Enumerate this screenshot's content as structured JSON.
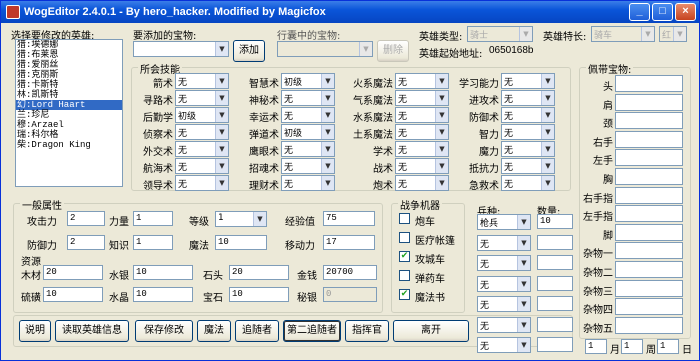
{
  "window": {
    "title": "WogEditor 2.4.0.1 - By  hero_hacker.  Modified by Magicfox",
    "minimize": "_",
    "maximize": "□",
    "close": "×"
  },
  "hero_list": {
    "label": "选择要修改的英雄:",
    "items": [
      "猎:埃德娜",
      "猎:布莱恩",
      "猎:爱丽丝",
      "猎:克丽斯",
      "猎:卡斯特",
      "林:凯斯特",
      "幻:Lord Haart",
      "兰:珍尼",
      "穆:Arzael",
      "瑞:科尔格",
      "柴:Dragon King"
    ],
    "selected_index": 6
  },
  "artifact_add": {
    "label": "要添加的宝物:",
    "value": "",
    "button": "添加"
  },
  "backpack": {
    "label": "行囊中的宝物:",
    "value": "",
    "button": "删除"
  },
  "hero_type": {
    "label": "英雄类型:",
    "value": "骑士"
  },
  "hero_specialty": {
    "label": "英雄特长:",
    "value": "骑车",
    "flag": "红"
  },
  "hero_address": {
    "label": "英雄起始地址:",
    "value": "0650168b"
  },
  "skills": {
    "title": "所会技能",
    "items": [
      {
        "name": "箭术",
        "value": "无"
      },
      {
        "name": "寻路术",
        "value": "无"
      },
      {
        "name": "后勤学",
        "value": "初级"
      },
      {
        "name": "侦察术",
        "value": "无"
      },
      {
        "name": "外交术",
        "value": "无"
      },
      {
        "name": "航海术",
        "value": "无"
      },
      {
        "name": "领导术",
        "value": "无"
      },
      {
        "name": "智慧术",
        "value": "初级"
      },
      {
        "name": "神秘术",
        "value": "无"
      },
      {
        "name": "幸运术",
        "value": "无"
      },
      {
        "name": "弹道术",
        "value": "初级"
      },
      {
        "name": "鹰眼术",
        "value": "无"
      },
      {
        "name": "招魂术",
        "value": "无"
      },
      {
        "name": "理财术",
        "value": "无"
      },
      {
        "name": "火系魔法",
        "value": "无"
      },
      {
        "name": "气系魔法",
        "value": "无"
      },
      {
        "name": "水系魔法",
        "value": "无"
      },
      {
        "name": "土系魔法",
        "value": "无"
      },
      {
        "name": "学术",
        "value": "无"
      },
      {
        "name": "战术",
        "value": "无"
      },
      {
        "name": "炮术",
        "value": "无"
      },
      {
        "name": "学习能力",
        "value": "无"
      },
      {
        "name": "进攻术",
        "value": "无"
      },
      {
        "name": "防御术",
        "value": "无"
      },
      {
        "name": "智力",
        "value": "无"
      },
      {
        "name": "魔力",
        "value": "无"
      },
      {
        "name": "抵抗力",
        "value": "无"
      },
      {
        "name": "急救术",
        "value": "无"
      }
    ]
  },
  "general": {
    "title": "一般属性",
    "attack": {
      "label": "攻击力",
      "value": "2"
    },
    "power": {
      "label": "力量",
      "value": "1"
    },
    "level": {
      "label": "等级",
      "value": "1"
    },
    "experience": {
      "label": "经验值",
      "value": "75"
    },
    "defense": {
      "label": "防御力",
      "value": "2"
    },
    "knowledge": {
      "label": "知识",
      "value": "1"
    },
    "mana": {
      "label": "魔法",
      "value": "10"
    },
    "movement": {
      "label": "移动力",
      "value": "17"
    }
  },
  "resources": {
    "title": "资源",
    "wood": {
      "label": "木材",
      "value": "20"
    },
    "mercury": {
      "label": "水银",
      "value": "10"
    },
    "ore": {
      "label": "石头",
      "value": "20"
    },
    "gold": {
      "label": "金钱",
      "value": "20700"
    },
    "sulfur": {
      "label": "硫磺",
      "value": "10"
    },
    "crystal": {
      "label": "水晶",
      "value": "10"
    },
    "gems": {
      "label": "宝石",
      "value": "10"
    },
    "mithril": {
      "label": "秘银",
      "value": "0"
    }
  },
  "war_machines": {
    "title": "战争机器",
    "items": [
      {
        "label": "炮车",
        "checked": false
      },
      {
        "label": "医疗帐篷",
        "checked": false
      },
      {
        "label": "攻城车",
        "checked": true
      },
      {
        "label": "弹药车",
        "checked": false
      },
      {
        "label": "魔法书",
        "checked": true
      }
    ],
    "check_mark": "✔"
  },
  "troops": {
    "type_label": "兵种:",
    "count_label": "数量:",
    "slots": [
      {
        "type": "枪兵",
        "count": "10"
      },
      {
        "type": "无",
        "count": ""
      },
      {
        "type": "无",
        "count": ""
      },
      {
        "type": "无",
        "count": ""
      },
      {
        "type": "无",
        "count": ""
      },
      {
        "type": "无",
        "count": ""
      },
      {
        "type": "无",
        "count": ""
      }
    ]
  },
  "equipped": {
    "title": "佩带宝物:",
    "slots": [
      "头",
      "肩",
      "颈",
      "右手",
      "左手",
      "胸",
      "右手指",
      "左手指",
      "脚",
      "杂物一",
      "杂物二",
      "杂物三",
      "杂物四",
      "杂物五"
    ]
  },
  "date": {
    "month": "1",
    "month_label": "月",
    "week": "1",
    "week_label": "周",
    "day": "1",
    "day_label": "日"
  },
  "buttons": {
    "help": "说明",
    "read": "读取英雄信息",
    "save": "保存修改",
    "magic": "魔法",
    "follower": "追随者",
    "follower2": "第二追随者",
    "commander": "指挥官",
    "leave": "离开"
  },
  "colors": {
    "titlebar": "#0a55d9",
    "selection": "#316ac5",
    "check": "#21a121"
  }
}
